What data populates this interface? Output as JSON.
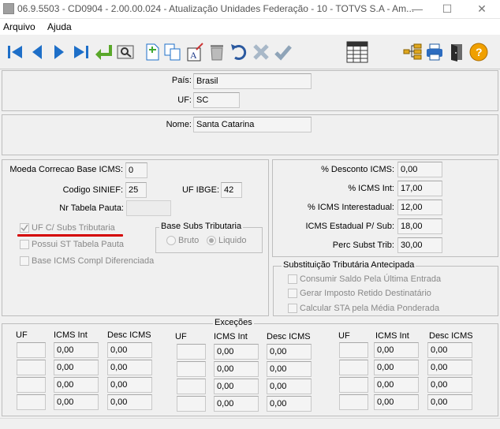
{
  "window": {
    "title": "06.9.5503 - CD0904 - 2.00.00.024 - Atualização Unidades Federação - 10 - TOTVS S.A - Am..."
  },
  "menu": {
    "arquivo": "Arquivo",
    "ajuda": "Ajuda"
  },
  "toolbar": {
    "icons": [
      "first-record-icon",
      "previous-record-icon",
      "next-record-icon",
      "last-record-icon",
      "confirm-enter-icon",
      "search-icon",
      "new-record-icon",
      "copy-record-icon",
      "edit-text-icon",
      "delete-icon",
      "undo-icon",
      "cancel-icon",
      "confirm-icon",
      "grid-view-icon",
      "tree-structure-icon",
      "print-icon",
      "exit-door-icon",
      "help-icon"
    ]
  },
  "header": {
    "pais_label": "País:",
    "pais_value": "Brasil",
    "uf_label": "UF:",
    "uf_value": "SC",
    "nome_label": "Nome:",
    "nome_value": "Santa Catarina"
  },
  "left": {
    "moeda_label": "Moeda Correcao Base ICMS:",
    "moeda_value": "0",
    "codigo_label": "Codigo SINIEF:",
    "codigo_value": "25",
    "ibge_label": "UF IBGE:",
    "ibge_value": "42",
    "pauta_label": "Nr Tabela Pauta:",
    "pauta_value": "",
    "cb_uf_subs": "UF C/ Subs Tributaria",
    "cb_possui_st": "Possui ST Tabela Pauta",
    "cb_base_icms": "Base ICMS Compl Diferenciada",
    "base_subs_title": "Base Subs Tributaria",
    "radio_bruto": "Bruto",
    "radio_liquido": "Liquido"
  },
  "right": {
    "desconto_label": "% Desconto ICMS:",
    "desconto_value": "0,00",
    "icms_int_label": "% ICMS Int:",
    "icms_int_value": "17,00",
    "icms_inter_label": "% ICMS Interestadual:",
    "icms_inter_value": "12,00",
    "icms_est_label": "ICMS Estadual P/ Sub:",
    "icms_est_value": "18,00",
    "perc_label": "Perc Subst Trib:",
    "perc_value": "30,00",
    "st_title": "Substituição Tributária Antecipada",
    "cb_consumir": "Consumir Saldo Pela Última Entrada",
    "cb_gerar": "Gerar Imposto Retido Destinatário",
    "cb_calcular": "Calcular STA pela Média Ponderada"
  },
  "excecoes": {
    "title": "Exceções",
    "col_uf": "UF",
    "col_icms": "ICMS Int",
    "col_desc": "Desc ICMS",
    "value": "0,00"
  },
  "colors": {
    "accent_underline": "#d40000",
    "panel_border": "#bdbdbd",
    "bg": "#f0f0f0"
  }
}
